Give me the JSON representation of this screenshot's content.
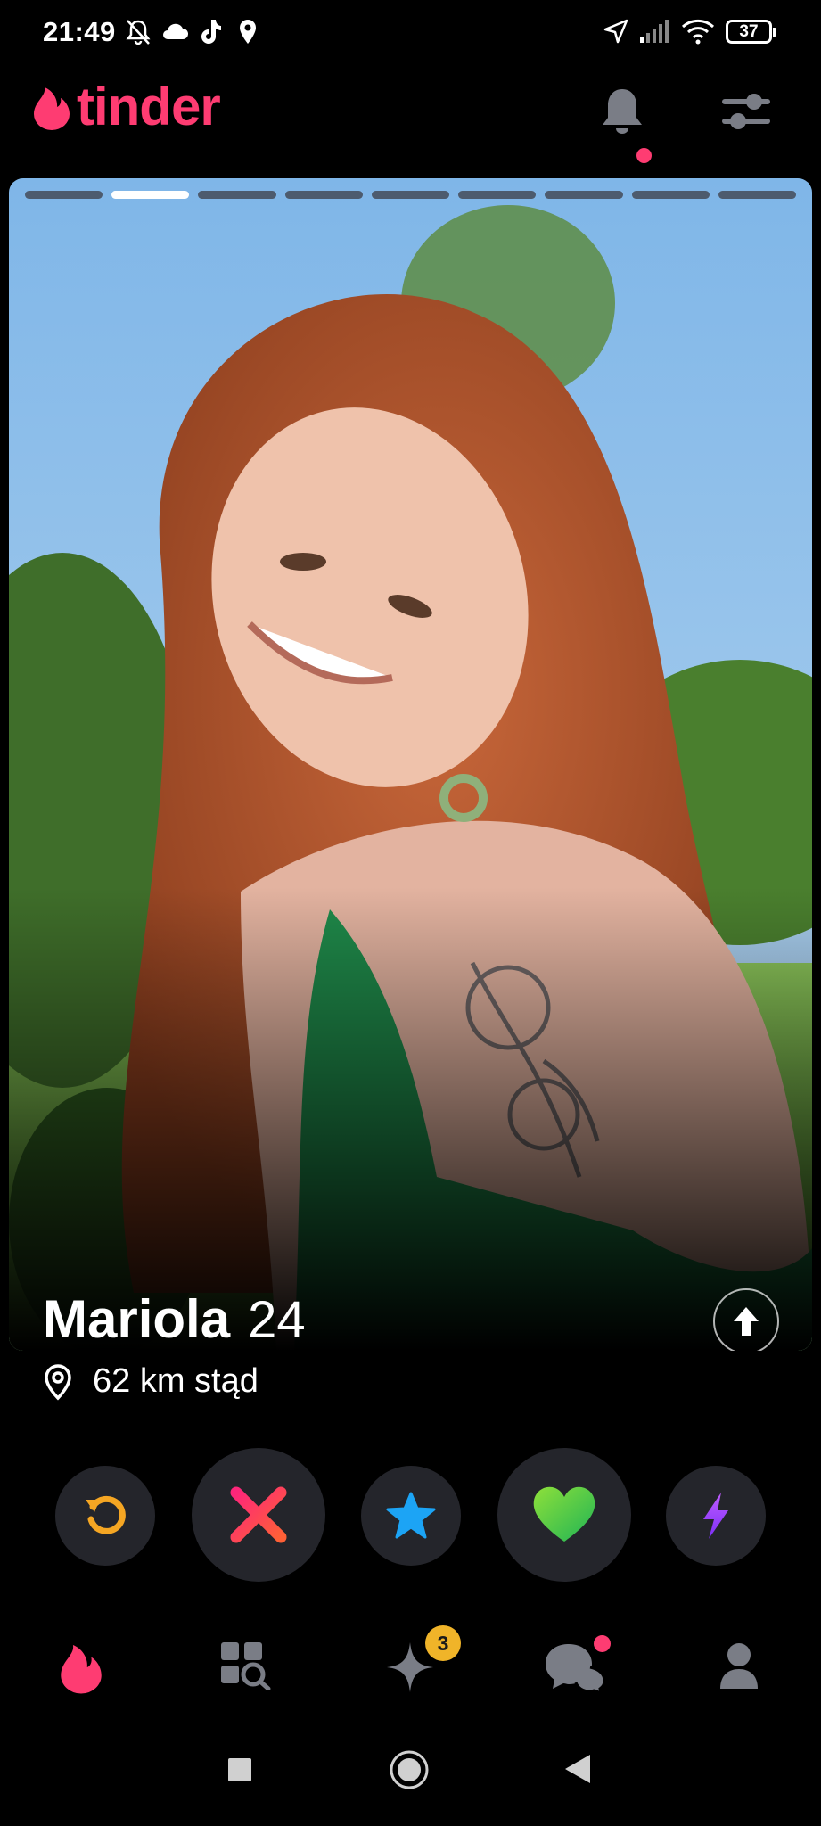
{
  "status_bar": {
    "time": "21:49",
    "battery": "37",
    "icons": [
      "mute-bell-icon",
      "cloud-icon",
      "tiktok-icon",
      "location-pin-icon",
      "location-arrow-icon",
      "signal-icon",
      "wifi-icon",
      "battery-icon"
    ]
  },
  "header": {
    "logo_text": "tinder",
    "icons": [
      "flame-icon",
      "notification-bell-icon",
      "filter-sliders-icon"
    ],
    "accent_color": "#fe3c72"
  },
  "profile": {
    "photo_count": 9,
    "active_photo_index": 1,
    "name": "Mariola",
    "age": "24",
    "distance": "62 km stąd"
  },
  "actions": [
    {
      "name": "rewind",
      "icon": "rewind-icon",
      "color": "#f5a623"
    },
    {
      "name": "nope",
      "icon": "x-icon",
      "color": "#fe3c72"
    },
    {
      "name": "super-like",
      "icon": "star-icon",
      "color": "#1ca4f5"
    },
    {
      "name": "like",
      "icon": "heart-icon",
      "color": "#4cd35a"
    },
    {
      "name": "boost",
      "icon": "lightning-icon",
      "color": "#a244fa"
    }
  ],
  "bottom_nav": {
    "items": [
      {
        "name": "home",
        "icon": "flame-icon",
        "active": true
      },
      {
        "name": "explore",
        "icon": "explore-grid-icon"
      },
      {
        "name": "likes",
        "icon": "sparkle-icon",
        "badge": "3"
      },
      {
        "name": "messages",
        "icon": "chat-icon",
        "dot": true
      },
      {
        "name": "profile",
        "icon": "person-icon"
      }
    ]
  }
}
